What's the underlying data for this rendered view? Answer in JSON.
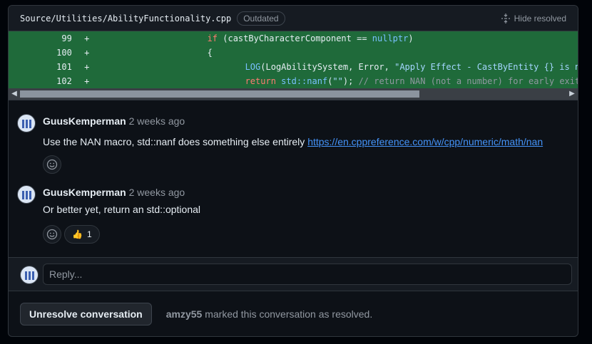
{
  "file": {
    "path": "Source/Utilities/AbilityFunctionality.cpp",
    "status_badge": "Outdated",
    "hide_resolved_label": "Hide resolved"
  },
  "diff": {
    "lines": [
      {
        "number": "99",
        "sign": "+"
      },
      {
        "number": "100",
        "sign": "+"
      },
      {
        "number": "101",
        "sign": "+"
      },
      {
        "number": "102",
        "sign": "+"
      }
    ],
    "code": {
      "l99_kw": "if",
      "l99_rest": " (castByCharacterComponent == ",
      "l99_null": "nullptr",
      "l99_end": ")",
      "l100": "{",
      "l101_fn": "LOG",
      "l101_rest": "(LogAbilitySystem, Error, ",
      "l101_str": "\"Apply Effect - CastByEntity {} is not a c",
      "l102_kw": "return",
      "l102_ns": " std::nanf",
      "l102_paren": "(",
      "l102_str": "\"\"",
      "l102_end": "); ",
      "l102_cm": "// return NAN (not a number) for early exit"
    }
  },
  "comments": [
    {
      "author": "GuusKemperman",
      "time": "2 weeks ago",
      "text": "Use the NAN macro, std::nanf does something else entirely ",
      "link": "https://en.cppreference.com/w/cpp/numeric/math/nan"
    },
    {
      "author": "GuusKemperman",
      "time": "2 weeks ago",
      "text": "Or better yet, return an std::optional",
      "reaction_emoji": "👍",
      "reaction_count": "1"
    }
  ],
  "more_options": "•••",
  "reply": {
    "placeholder": "Reply..."
  },
  "resolution": {
    "button_label": "Unresolve conversation",
    "user": "amzy55",
    "text": " marked this conversation as resolved."
  },
  "colors": {
    "added_line_bg": "#1f6a3a",
    "link": "#4493f8"
  },
  "icons": [
    "fold-icon",
    "avatar",
    "smiley-icon",
    "thumbs-up-icon",
    "kebab-icon",
    "scroll-left-icon",
    "scroll-right-icon"
  ]
}
